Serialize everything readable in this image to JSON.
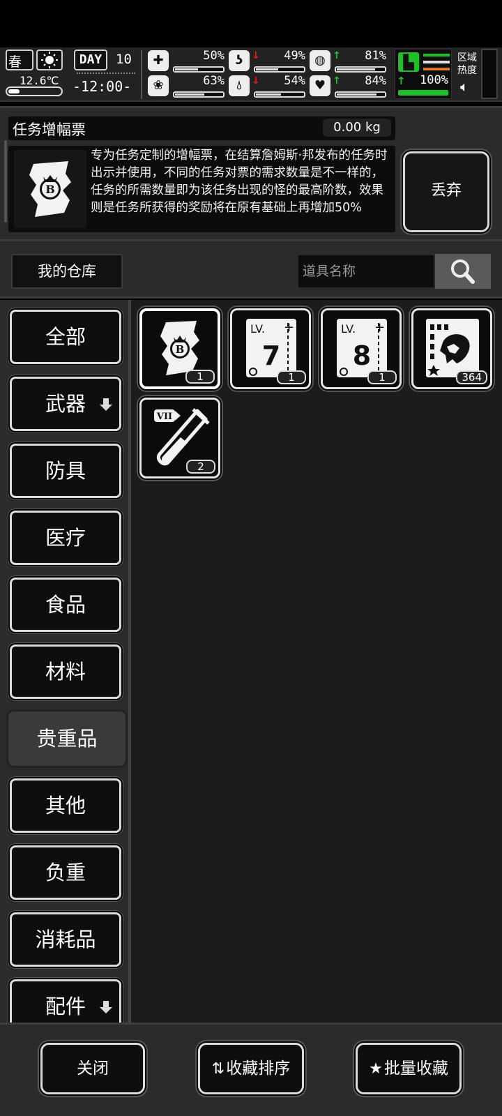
{
  "status": {
    "season": "春",
    "temperature": "12.6℃",
    "day_label": "DAY",
    "day_number": "10",
    "time": "-12:00-",
    "stats": [
      {
        "name": "health",
        "icon": "medkit-icon",
        "trend": "",
        "value": "50%",
        "fill": 0.5
      },
      {
        "name": "stomach",
        "icon": "stomach-icon",
        "trend": "down",
        "value": "49%",
        "fill": 0.49
      },
      {
        "name": "stamina",
        "icon": "capsule-icon",
        "trend": "up",
        "value": "81%",
        "fill": 0.81
      },
      {
        "name": "mood",
        "icon": "brain-icon",
        "trend": "",
        "value": "63%",
        "fill": 0.63
      },
      {
        "name": "water",
        "icon": "water-drop-icon",
        "trend": "down",
        "value": "54%",
        "fill": 0.54
      },
      {
        "name": "heart",
        "icon": "heart-icon",
        "trend": "up",
        "value": "84%",
        "fill": 0.84
      },
      {
        "name": "leg",
        "icon": "boot-icon",
        "trend": "up",
        "value": "100%",
        "fill": 1.0
      }
    ],
    "zone_heat_label": "区域\n热度"
  },
  "item_info": {
    "name": "任务增幅票",
    "weight": "0.00 kg",
    "description": "专为任务定制的增幅票，在结算詹姆斯·邦发布的任务时出示并使用，不同的任务对票的需求数量是不一样的，任务的所需数量即为该任务出现的怪的最高阶数，效果则是任务所获得的奖励将在原有基础上再增加50%",
    "discard_label": "丢弃"
  },
  "search": {
    "warehouse_label": "我的仓库",
    "placeholder": "道具名称"
  },
  "categories": [
    {
      "label": "全部",
      "active": false,
      "dropdown": false
    },
    {
      "label": "武器",
      "active": false,
      "dropdown": true
    },
    {
      "label": "防具",
      "active": false,
      "dropdown": false
    },
    {
      "label": "医疗",
      "active": false,
      "dropdown": false
    },
    {
      "label": "食品",
      "active": false,
      "dropdown": false
    },
    {
      "label": "材料",
      "active": false,
      "dropdown": false
    },
    {
      "label": "贵重品",
      "active": true,
      "dropdown": false
    },
    {
      "label": "其他",
      "active": false,
      "dropdown": false
    },
    {
      "label": "负重",
      "active": false,
      "dropdown": false
    },
    {
      "label": "消耗品",
      "active": false,
      "dropdown": false
    },
    {
      "label": "配件",
      "active": false,
      "dropdown": true
    }
  ],
  "items": [
    {
      "name": "quest-boost-ticket",
      "icon": "ticket-icon",
      "count": "1",
      "selected": true
    },
    {
      "name": "lv7-voucher",
      "icon": "lv7-card-icon",
      "level_label": "LV.",
      "level": "7",
      "count": "1",
      "selected": false
    },
    {
      "name": "lv8-voucher",
      "icon": "lv8-card-icon",
      "level_label": "LV.",
      "level": "8",
      "count": "1",
      "selected": false
    },
    {
      "name": "bounty-card",
      "icon": "bounty-card-icon",
      "count": "364",
      "selected": false
    },
    {
      "name": "test-tube",
      "icon": "test-tube-icon",
      "tier": "VII",
      "count": "2",
      "selected": false
    }
  ],
  "bottom": {
    "close_label": "关闭",
    "sort_label": "收藏排序",
    "batch_label": "批量收藏"
  }
}
